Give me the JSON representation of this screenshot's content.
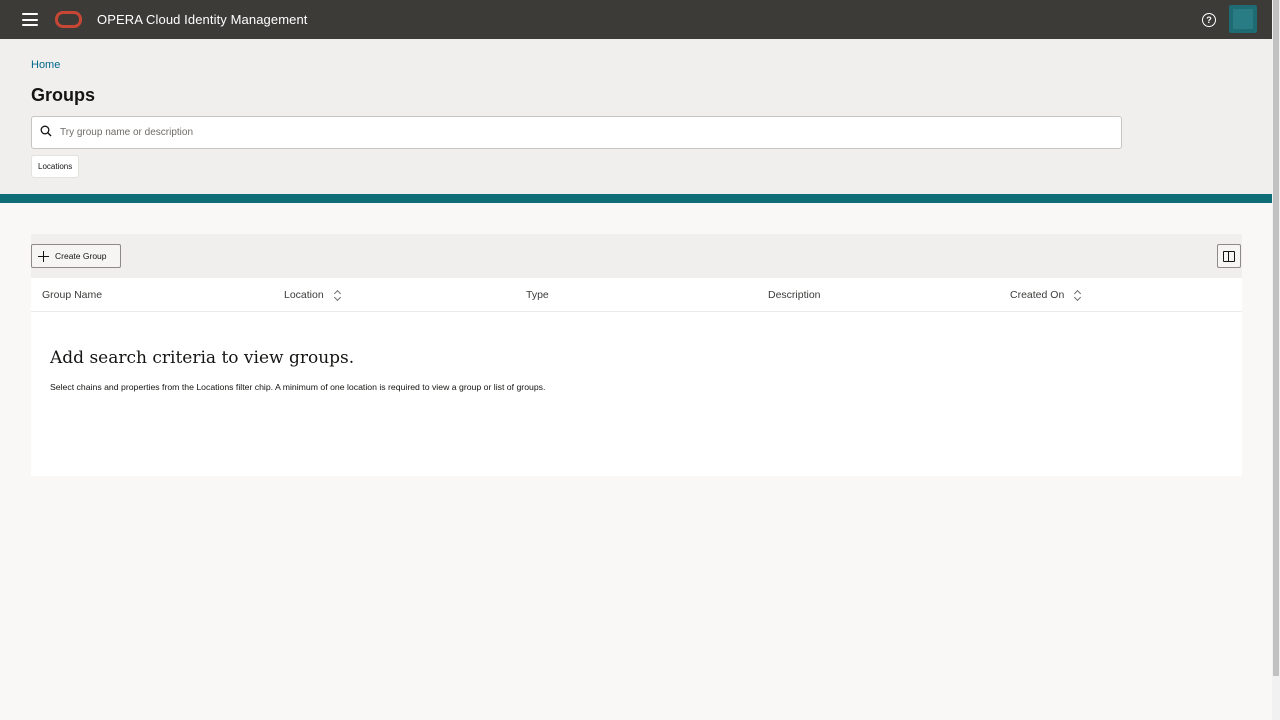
{
  "app": {
    "title": "OPERA Cloud Identity Management",
    "brand_color": "#c74634",
    "header_color": "#3d3b38",
    "accent_color": "#0f6d77"
  },
  "topbar": {
    "menu_icon": "hamburger-menu-icon",
    "logo_icon": "oracle-logo-icon",
    "help_icon": "help-circle-icon",
    "avatar_icon": "user-avatar"
  },
  "breadcrumb": {
    "home": "Home"
  },
  "page": {
    "title": "Groups"
  },
  "search": {
    "placeholder": "Try group name or description",
    "value": "",
    "icon": "search-icon"
  },
  "filters": {
    "chips": [
      "Locations"
    ]
  },
  "toolbar": {
    "create_label": "Create Group",
    "create_icon": "plus-icon",
    "columns_icon": "column-layout-icon"
  },
  "table": {
    "columns": [
      {
        "label": "Group Name",
        "sortable": false
      },
      {
        "label": "Location",
        "sortable": true
      },
      {
        "label": "Type",
        "sortable": false
      },
      {
        "label": "Description",
        "sortable": false
      },
      {
        "label": "Created On",
        "sortable": true
      }
    ],
    "rows": [],
    "empty_title": "Add search criteria to view groups.",
    "empty_description": "Select chains and properties from the Locations filter chip. A minimum of one location is required to view a group or list of groups."
  }
}
